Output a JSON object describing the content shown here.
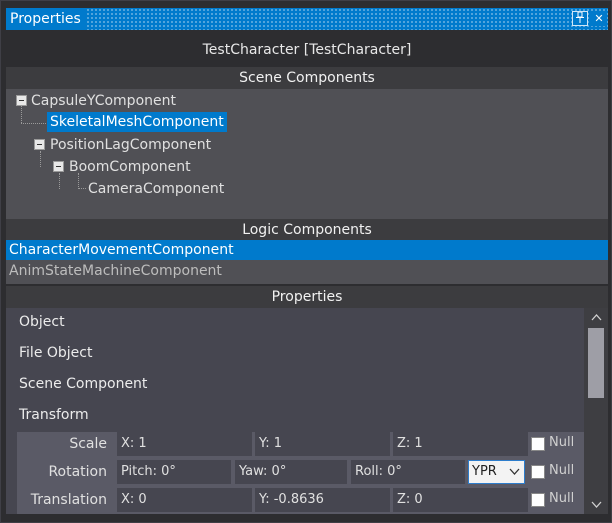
{
  "window": {
    "title": "Properties",
    "pin_icon": "pin-icon",
    "close_icon": "close-icon"
  },
  "object_title": "TestCharacter [TestCharacter]",
  "scene": {
    "header": "Scene Components",
    "nodes": [
      {
        "label": "CapsuleYComponent",
        "expanded": true,
        "selected": false
      },
      {
        "label": "SkeletalMeshComponent",
        "expanded": false,
        "selected": true
      },
      {
        "label": "PositionLagComponent",
        "expanded": true,
        "selected": false
      },
      {
        "label": "BoomComponent",
        "expanded": true,
        "selected": false
      },
      {
        "label": "CameraComponent",
        "expanded": false,
        "selected": false
      }
    ]
  },
  "logic": {
    "header": "Logic Components",
    "items": [
      {
        "label": "CharacterMovementComponent",
        "selected": true
      },
      {
        "label": "AnimStateMachineComponent",
        "selected": false
      }
    ]
  },
  "properties": {
    "header": "Properties",
    "categories": [
      "Object",
      "File Object",
      "Scene Component",
      "Transform"
    ],
    "rows": [
      {
        "label": "Scale",
        "fields": [
          "X: 1",
          "Y: 1",
          "Z: 1"
        ],
        "null_label": "Null",
        "null_checked": false
      },
      {
        "label": "Rotation",
        "fields": [
          "Pitch: 0°",
          "Yaw: 0°",
          "Roll: 0°"
        ],
        "mode": "YPR",
        "null_label": "Null",
        "null_checked": false
      },
      {
        "label": "Translation",
        "fields": [
          "X: 0",
          "Y: -0.8636",
          "Z: 0"
        ],
        "null_label": "Null",
        "null_checked": false
      }
    ]
  },
  "colors": {
    "accent": "#007acc",
    "background": "#2d2d30",
    "panel": "#505055",
    "section_header": "#3c3c3f"
  }
}
